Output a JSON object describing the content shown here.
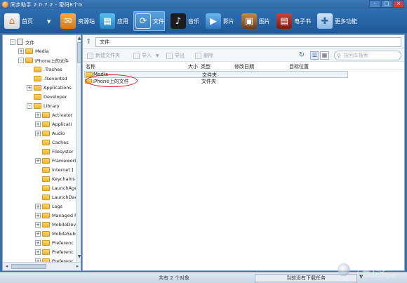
{
  "window": {
    "title": "同步助手 2.0.7.2 - 密码8个G",
    "controls": [
      "-",
      "□",
      "×"
    ]
  },
  "toolbar": {
    "items": [
      {
        "label": "首页",
        "icon": "home-icon"
      },
      {
        "label": "资源站",
        "icon": "store-icon"
      },
      {
        "label": "应用",
        "icon": "app-icon"
      },
      {
        "label": "文件",
        "icon": "file-icon",
        "active": true
      },
      {
        "label": "音乐",
        "icon": "music-icon"
      },
      {
        "label": "影片",
        "icon": "video-icon"
      },
      {
        "label": "图片",
        "icon": "photo-icon"
      },
      {
        "label": "电子书",
        "icon": "ebook-icon"
      },
      {
        "label": "更多功能",
        "icon": "more-icon"
      }
    ]
  },
  "tree": {
    "items": [
      {
        "label": "文件",
        "level": 0,
        "expander": "-",
        "type": "device"
      },
      {
        "label": "Media",
        "level": 1,
        "expander": "+",
        "type": "folder"
      },
      {
        "label": "iPhone上的文件",
        "level": 1,
        "expander": "-",
        "type": "folder"
      },
      {
        "label": ".Trashes",
        "level": 2,
        "expander": "",
        "type": "folder"
      },
      {
        "label": ".fseventsd",
        "level": 2,
        "expander": "",
        "type": "folder"
      },
      {
        "label": "Applications",
        "level": 2,
        "expander": "+",
        "type": "folder"
      },
      {
        "label": "Developer",
        "level": 2,
        "expander": "",
        "type": "folder"
      },
      {
        "label": "Library",
        "level": 2,
        "expander": "-",
        "type": "folder"
      },
      {
        "label": "Activator",
        "level": 3,
        "expander": "+",
        "type": "folder"
      },
      {
        "label": "Applicati",
        "level": 3,
        "expander": "+",
        "type": "folder"
      },
      {
        "label": "Audio",
        "level": 3,
        "expander": "+",
        "type": "folder"
      },
      {
        "label": "Caches",
        "level": 3,
        "expander": "",
        "type": "folder"
      },
      {
        "label": "Filesyster",
        "level": 3,
        "expander": "",
        "type": "folder"
      },
      {
        "label": "Framework",
        "level": 3,
        "expander": "+",
        "type": "folder"
      },
      {
        "label": "Internet ]",
        "level": 3,
        "expander": "",
        "type": "folder"
      },
      {
        "label": "Keychains",
        "level": 3,
        "expander": "",
        "type": "folder"
      },
      {
        "label": "LaunchAge",
        "level": 3,
        "expander": "",
        "type": "folder"
      },
      {
        "label": "LaunchDaer",
        "level": 3,
        "expander": "",
        "type": "folder"
      },
      {
        "label": "Logs",
        "level": 3,
        "expander": "+",
        "type": "folder"
      },
      {
        "label": "Managed P",
        "level": 3,
        "expander": "+",
        "type": "folder"
      },
      {
        "label": "MobileDev",
        "level": 3,
        "expander": "+",
        "type": "folder"
      },
      {
        "label": "MobileSub",
        "level": 3,
        "expander": "+",
        "type": "folder"
      },
      {
        "label": "Preferenc",
        "level": 3,
        "expander": "+",
        "type": "folder"
      },
      {
        "label": "Preferenc",
        "level": 3,
        "expander": "+",
        "type": "folder"
      },
      {
        "label": "Preferenc",
        "level": 3,
        "expander": "+",
        "type": "folder"
      }
    ]
  },
  "path": {
    "value": "文件"
  },
  "actions": {
    "new_folder": "新建文件夹",
    "import": "导入",
    "export": "导出",
    "delete": "删除"
  },
  "search": {
    "placeholder": "按回车搜索"
  },
  "columns": {
    "name": "名称",
    "size": "大小",
    "type": "类型",
    "modified": "修改日期",
    "target": "目标位置"
  },
  "files": [
    {
      "name": "Media",
      "size": "",
      "type": "文件夹",
      "modified": "",
      "target": ""
    },
    {
      "name": "iPhone上的文件",
      "size": "",
      "type": "文件夹",
      "modified": "",
      "target": ""
    }
  ],
  "status": {
    "count": "共有 2 个对象",
    "downloads": "当前没有下载任务"
  },
  "watermark": {
    "line1": "下载中心",
    "line2": "xiazaizhongxin"
  }
}
